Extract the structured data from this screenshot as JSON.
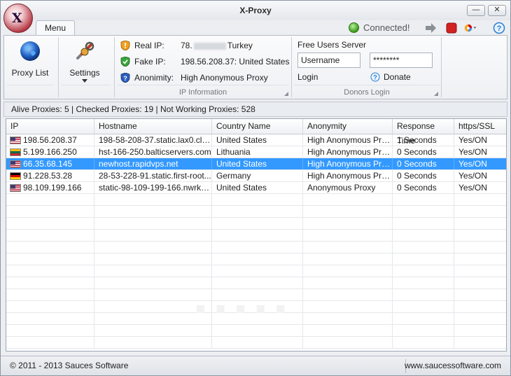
{
  "window": {
    "title": "X-Proxy"
  },
  "tabs": {
    "menu": "Menu"
  },
  "status": {
    "text": "Connected!"
  },
  "ribbon": {
    "proxy_list": "Proxy List",
    "settings": "Settings",
    "ip_info": {
      "real_ip_label": "Real IP:",
      "real_ip_prefix": "78.",
      "real_ip_suffix": "Turkey",
      "fake_ip_label": "Fake IP:",
      "fake_ip_value": "198.56.208.37: United States",
      "anonimity_label": "Anonimity:",
      "anonimity_value": "High Anonymous Proxy",
      "group_label": "IP Information"
    },
    "donors": {
      "server_label": "Free Users Server",
      "username_value": "Username",
      "password_value": "********",
      "login": "Login",
      "donate": "Donate",
      "group_label": "Donors Login"
    }
  },
  "stats": {
    "text": "Alive Proxies: 5 | Checked Proxies: 19 | Not Working Proxies: 528"
  },
  "grid": {
    "columns": [
      "IP",
      "Hostname",
      "Country Name",
      "Anonymity",
      "Response Time",
      "https/SSL"
    ],
    "rows": [
      {
        "flag": "us",
        "ip": "198.56.208.37",
        "host": "198-58-208-37.static.lax0.clo...",
        "country": "United States",
        "anon": "High Anonymous Proxy",
        "time": "1 Seconds",
        "ssl": "Yes/ON"
      },
      {
        "flag": "lt",
        "ip": "5.199.166.250",
        "host": "hst-166-250.balticservers.com",
        "country": "Lithuania",
        "anon": "High Anonymous Proxy",
        "time": "0 Seconds",
        "ssl": "Yes/ON"
      },
      {
        "flag": "us",
        "ip": "66.35.68.145",
        "host": "newhost.rapidvps.net",
        "country": "United States",
        "anon": "High Anonymous Proxy",
        "time": "0 Seconds",
        "ssl": "Yes/ON",
        "selected": true
      },
      {
        "flag": "de",
        "ip": "91.228.53.28",
        "host": "28-53-228-91.static.first-root...",
        "country": "Germany",
        "anon": "High Anonymous Proxy",
        "time": "0 Seconds",
        "ssl": "Yes/ON"
      },
      {
        "flag": "us",
        "ip": "98.109.199.166",
        "host": "static-98-109-199-166.nwrknj...",
        "country": "United States",
        "anon": "Anonymous Proxy",
        "time": "0 Seconds",
        "ssl": "Yes/ON"
      }
    ]
  },
  "footer": {
    "copyright": "© 2011 - 2013 Sauces Software",
    "website": "www.saucessoftware.com"
  },
  "colors": {
    "selection": "#3399ff",
    "connected": "#3c9a1a"
  }
}
